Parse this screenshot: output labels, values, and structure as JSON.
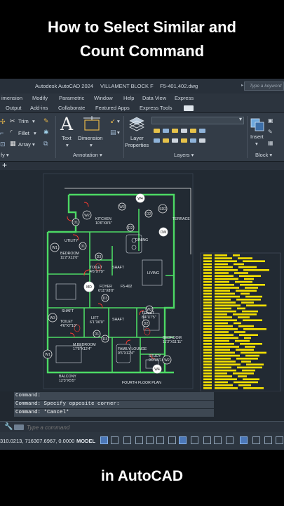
{
  "headline": {
    "line1": "How to Select Similar and",
    "line2": "Count Command"
  },
  "footer_caption": "in AutoCAD",
  "titlebar": {
    "app": "Autodesk AutoCAD 2024",
    "project": "VILLAMENT BLOCK F",
    "file": "F5-401,402.dwg",
    "search_placeholder": "Type a keyword"
  },
  "menu": [
    "imension",
    "Modify",
    "Parametric",
    "Window",
    "Help",
    "Data View",
    "Express"
  ],
  "ribbon_tabs": [
    "Output",
    "Add-ins",
    "Collaborate",
    "Featured Apps",
    "Express Tools"
  ],
  "ribbon": {
    "trim": "Trim",
    "fillet": "Fillet",
    "array": "Array",
    "text": "Text",
    "dimension": "Dimension",
    "layer_properties_1": "Layer",
    "layer_properties_2": "Properties",
    "insert": "Insert",
    "panels": {
      "modify": "fy ▾",
      "annotation": "Annotation ▾",
      "layers": "Layers ▾",
      "block": "Block ▾"
    }
  },
  "plan_labels": {
    "kitchen": "KITCHEN",
    "kitchen_size": "10'6\"X8'4\"",
    "utility": "UTILITY",
    "terrace": "TERRACE",
    "dining": "DINING",
    "bedroom1": "BEDROOM",
    "bedroom1_size": "11'2\"X12'0\"",
    "toilet1": "TOILET",
    "toilet1_size": "4'6\"X7'9\"",
    "shaft1": "SHAFT",
    "living": "LIVING",
    "foyer": "FOYER",
    "foyer_size": "6'11\"X8'0\"",
    "f5_402": "F5-402",
    "shaft2": "SHAFT",
    "toilet2": "TOILET",
    "toilet2_size": "4'6\"X7'10\"",
    "lift": "LIFT",
    "lift_size": "6'1\"X6'0\"",
    "shaft3": "SHAFT",
    "toilet3": "TOILET",
    "toilet3_size": "8'4\"X7'5\"",
    "bedroom2": "BEDROOM",
    "bedroom2_size": "11'2\"X11'11\"",
    "mbedroom": "M.BEDROOM",
    "mbedroom_size": "17'5\"X12'4\"",
    "family_lounge": "FAMILY LOUNGE",
    "family_lounge_size": "9'6\"X12'4\"",
    "study": "STUDY",
    "study_size": "9'0\"X5'10\"",
    "balcony": "BALCONY",
    "balcony_size": "12'3\"X5'5\"",
    "floor_plan": "FOURTH FLOOR PLAN",
    "tags": [
      "W2",
      "D1",
      "D2",
      "W3",
      "D2",
      "W4",
      "SD2",
      "DW",
      "D1",
      "W1",
      "D3",
      "D3",
      "W3",
      "D1",
      "W2",
      "D2",
      "D3",
      "W4",
      "W1",
      "W2"
    ],
    "mid_tag": "MD"
  },
  "command_history": [
    "Command:",
    "Command: Specify opposite corner:",
    "Command: *Cancel*"
  ],
  "command_placeholder": "Type a command",
  "status": {
    "coords": "310.0213, 716307.6967, 0.0000",
    "model": "MODEL"
  },
  "colors": {
    "canvas_bg": "#222a33",
    "wall": "#4cd964",
    "door_tag": "#e8e8e8",
    "table_yellow": "#f5e100",
    "accent_blue": "#4b77b7"
  }
}
